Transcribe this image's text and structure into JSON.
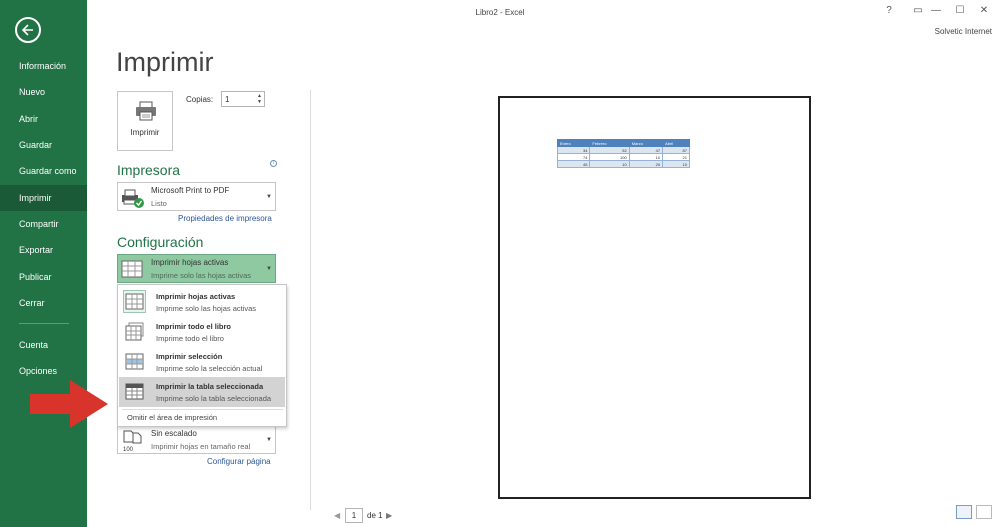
{
  "window": {
    "title": "Libro2 - Excel",
    "help": "?",
    "controls": [
      "▭",
      "—",
      "☐",
      "✕"
    ],
    "user": "Solvetic Internet"
  },
  "sidebar": {
    "items": [
      {
        "label": "Información"
      },
      {
        "label": "Nuevo"
      },
      {
        "label": "Abrir"
      },
      {
        "label": "Guardar"
      },
      {
        "label": "Guardar como"
      },
      {
        "label": "Imprimir",
        "active": true
      },
      {
        "label": "Compartir"
      },
      {
        "label": "Exportar"
      },
      {
        "label": "Publicar"
      },
      {
        "label": "Cerrar"
      },
      {
        "label": "Cuenta"
      },
      {
        "label": "Opciones"
      }
    ],
    "accent": "#217346"
  },
  "main": {
    "title": "Imprimir",
    "print_button": "Imprimir",
    "copies_label": "Copias:",
    "copies_value": "1",
    "printer_heading": "Impresora",
    "printer_name": "Microsoft Print to PDF",
    "printer_status": "Listo",
    "printer_props_link": "Propiedades de impresora",
    "config_heading": "Configuración",
    "config_selected_title": "Imprimir hojas activas",
    "config_selected_sub": "Imprime solo las hojas activas",
    "scaling_title": "Sin escalado",
    "scaling_sub": "Imprimir hojas en tamaño real",
    "page_setup_link": "Configurar página"
  },
  "menu": {
    "items": [
      {
        "title": "Imprimir hojas activas",
        "sub": "Imprime solo las hojas activas"
      },
      {
        "title": "Imprimir todo el libro",
        "sub": "Imprime todo el libro"
      },
      {
        "title": "Imprimir selección",
        "sub": "Imprime solo la selección actual"
      },
      {
        "title": "Imprimir la tabla seleccionada",
        "sub": "Imprime solo la tabla seleccionada"
      }
    ],
    "omit": "Omitir el área de impresión"
  },
  "preview": {
    "table_headers": [
      "Enero",
      "Febrero",
      "Marzo",
      "Abril"
    ],
    "table_rows": [
      [
        "34",
        "52",
        "47",
        "87"
      ],
      [
        "74",
        "100",
        "10",
        "21"
      ],
      [
        "45",
        "10",
        "20",
        "10"
      ]
    ]
  },
  "pager": {
    "prev": "◀",
    "current": "1",
    "of_label": "de 1",
    "next": "▶"
  }
}
